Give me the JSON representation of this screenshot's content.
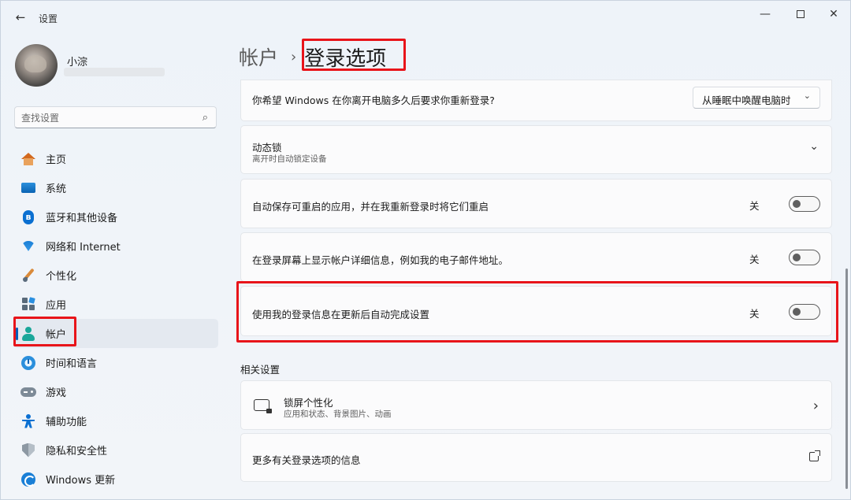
{
  "window": {
    "title": "设置",
    "back_glyph": "←",
    "minimize_glyph": "—",
    "close_glyph": "✕"
  },
  "user": {
    "name": "小淙"
  },
  "search": {
    "placeholder": "查找设置",
    "icon": "search-icon",
    "icon_glyph": "⌕"
  },
  "sidebar": {
    "items": [
      {
        "label": "主页",
        "icon": "home-icon"
      },
      {
        "label": "系统",
        "icon": "system-icon"
      },
      {
        "label": "蓝牙和其他设备",
        "icon": "bluetooth-icon",
        "glyph": "ʙ"
      },
      {
        "label": "网络和 Internet",
        "icon": "wifi-icon"
      },
      {
        "label": "个性化",
        "icon": "brush-icon"
      },
      {
        "label": "应用",
        "icon": "apps-icon"
      },
      {
        "label": "帐户",
        "icon": "account-icon",
        "active": true
      },
      {
        "label": "时间和语言",
        "icon": "clock-globe-icon"
      },
      {
        "label": "游戏",
        "icon": "gamepad-icon"
      },
      {
        "label": "辅助功能",
        "icon": "accessibility-icon"
      },
      {
        "label": "隐私和安全性",
        "icon": "shield-icon"
      },
      {
        "label": "Windows 更新",
        "icon": "update-icon"
      }
    ]
  },
  "breadcrumb": {
    "parent": "帐户",
    "separator": "›",
    "current": "登录选项"
  },
  "settings": {
    "require_signin": {
      "title": "你希望 Windows 在你离开电脑多久后要求你重新登录?",
      "dropdown_value": "从睡眠中唤醒电脑时",
      "dropdown_chevron": "⌄"
    },
    "dynamic_lock": {
      "title": "动态锁",
      "subtitle": "离开时自动锁定设备",
      "chevron": "⌄"
    },
    "auto_save_apps": {
      "title": "自动保存可重启的应用，并在我重新登录时将它们重启",
      "state_label": "关"
    },
    "show_account_details": {
      "title": "在登录屏幕上显示帐户详细信息，例如我的电子邮件地址。",
      "state_label": "关"
    },
    "use_signin_info": {
      "title": "使用我的登录信息在更新后自动完成设置",
      "state_label": "关"
    }
  },
  "related": {
    "section_title": "相关设置",
    "lock_screen": {
      "title": "锁屏个性化",
      "subtitle": "应用和状态、背景图片、动画",
      "chevron": "›"
    },
    "more_info": {
      "title": "更多有关登录选项的信息"
    }
  },
  "colors": {
    "highlight": "#e8141a",
    "accent": "#005fb8"
  }
}
